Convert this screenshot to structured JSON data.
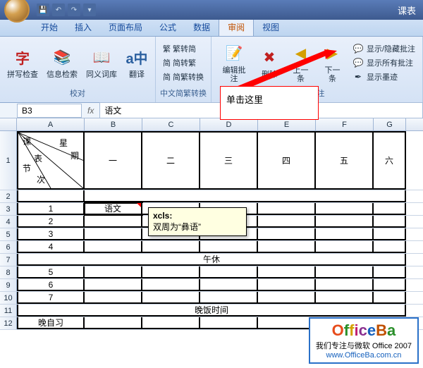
{
  "window": {
    "title": "课表"
  },
  "qat": [
    "save",
    "undo",
    "redo"
  ],
  "tabs": [
    {
      "label": "开始"
    },
    {
      "label": "插入"
    },
    {
      "label": "页面布局"
    },
    {
      "label": "公式"
    },
    {
      "label": "数据"
    },
    {
      "label": "审阅",
      "active": true
    },
    {
      "label": "视图"
    }
  ],
  "ribbon": {
    "proofing": {
      "label": "校对",
      "spell": {
        "lbl": "拼写检查",
        "glyph": "字"
      },
      "research": {
        "lbl": "信息检索"
      },
      "thesaurus": {
        "lbl": "同义词库"
      },
      "translate": {
        "lbl": "翻译",
        "glyph": "a中"
      }
    },
    "chinese": {
      "label": "中文简繁转换",
      "s2t": "繁 繁转简",
      "t2s": "简 简转繁",
      "conv": "简 简繁转换"
    },
    "comments": {
      "label": "批注",
      "new": "编辑批注",
      "del": "删除",
      "prev": "上一条",
      "next": "下一条",
      "show": "显示/隐藏批注",
      "showall": "显示所有批注",
      "ink": "显示墨迹"
    }
  },
  "namebox": "B3",
  "formula": "语文",
  "cols": [
    "A",
    "B",
    "C",
    "D",
    "E",
    "F",
    "G"
  ],
  "header_diag": {
    "t1": "课",
    "t2": "星",
    "t3": "表",
    "t4": "期",
    "t5": "节",
    "t6": "次"
  },
  "days": [
    "一",
    "二",
    "三",
    "四",
    "五",
    "六"
  ],
  "rows": {
    "r2": "",
    "r3_a": "1",
    "r3_b": "语文",
    "r4": "2",
    "r5": "3",
    "r6": "4",
    "r7_merged": "午休",
    "r8": "5",
    "r9": "6",
    "r10": "7",
    "r11_merged": "晚饭时间",
    "r12": "晚自习"
  },
  "comment": {
    "author": "xcls:",
    "text": "双周为“彝语”"
  },
  "callout": "单击这里",
  "logo": {
    "line1": "我们专注与微软 Office 2007",
    "line2": "www.OfficeBa.com.cn"
  }
}
